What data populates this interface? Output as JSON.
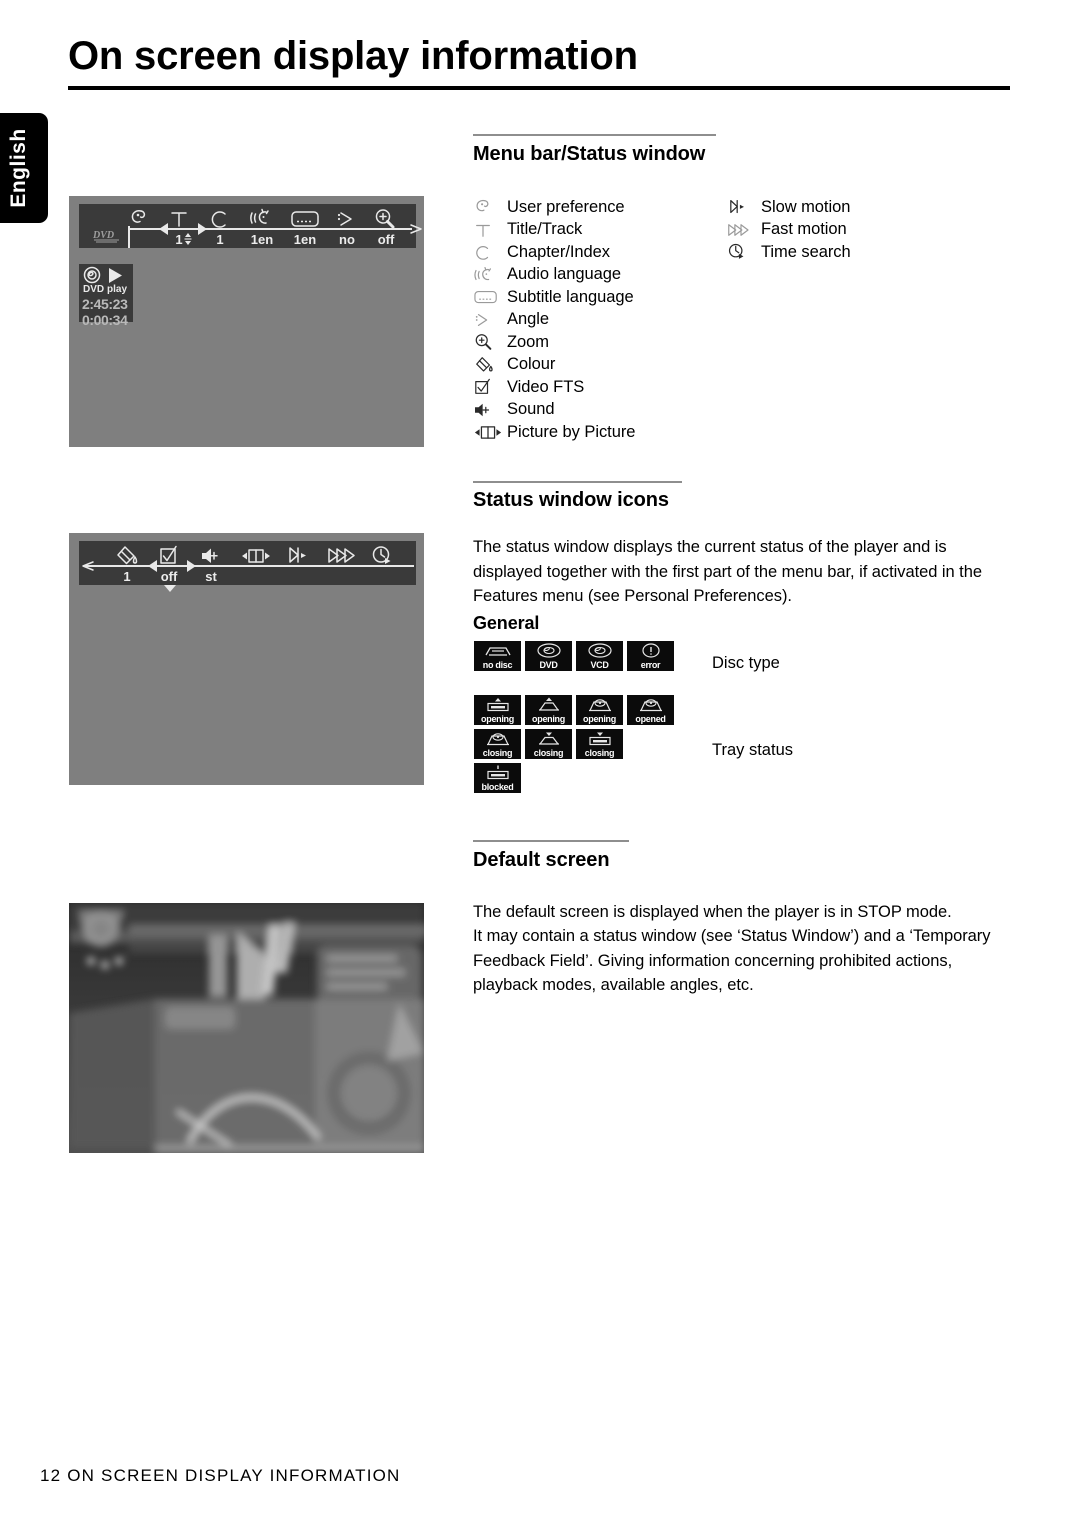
{
  "document": {
    "language_tab": "English",
    "page_title": "On screen display information",
    "footer": "12 ON SCREEN DISPLAY INFORMATION",
    "page_number": "12"
  },
  "sections": {
    "menu_bar": {
      "heading": "Menu bar/Status window",
      "icons_left": [
        {
          "icon": "user-preference-icon",
          "label": "User preference"
        },
        {
          "icon": "title-track-icon",
          "label": "Title/Track"
        },
        {
          "icon": "chapter-index-icon",
          "label": "Chapter/Index"
        },
        {
          "icon": "audio-language-icon",
          "label": "Audio language"
        },
        {
          "icon": "subtitle-language-icon",
          "label": "Subtitle language"
        },
        {
          "icon": "angle-icon",
          "label": "Angle"
        },
        {
          "icon": "zoom-icon",
          "label": "Zoom"
        },
        {
          "icon": "colour-icon",
          "label": "Colour"
        },
        {
          "icon": "video-fts-icon",
          "label": "Video FTS"
        },
        {
          "icon": "sound-icon",
          "label": "Sound"
        },
        {
          "icon": "picture-by-picture-icon",
          "label": "Picture by Picture"
        }
      ],
      "icons_right": [
        {
          "icon": "slow-motion-icon",
          "label": "Slow motion"
        },
        {
          "icon": "fast-motion-icon",
          "label": "Fast motion"
        },
        {
          "icon": "time-search-icon",
          "label": "Time search"
        }
      ]
    },
    "status_window": {
      "heading": "Status window icons",
      "body": "The status window displays the current status of the player and is displayed together with the first part of the menu bar, if activated in the Features menu (see Personal Preferences).",
      "general_heading": "General",
      "disc_type_label": "Disc type",
      "tray_status_label": "Tray status",
      "disc_type_tiles": [
        {
          "icon": "no-disc-icon",
          "caption": "no disc"
        },
        {
          "icon": "dvd-disc-icon",
          "caption": "DVD"
        },
        {
          "icon": "vcd-disc-icon",
          "caption": "VCD"
        },
        {
          "icon": "error-icon",
          "caption": "error"
        }
      ],
      "tray_status_tiles_row1": [
        {
          "icon": "tray-opening-1-icon",
          "caption": "opening"
        },
        {
          "icon": "tray-opening-2-icon",
          "caption": "opening"
        },
        {
          "icon": "tray-opening-3-icon",
          "caption": "opening"
        },
        {
          "icon": "tray-opened-icon",
          "caption": "opened"
        }
      ],
      "tray_status_tiles_row2": [
        {
          "icon": "tray-closing-1-icon",
          "caption": "closing"
        },
        {
          "icon": "tray-closing-2-icon",
          "caption": "closing"
        },
        {
          "icon": "tray-closing-3-icon",
          "caption": "closing"
        }
      ],
      "tray_status_tiles_row3": [
        {
          "icon": "tray-blocked-icon",
          "caption": "blocked"
        }
      ]
    },
    "default_screen": {
      "heading": "Default screen",
      "body_line1": "The default screen is displayed when the player is in STOP mode.",
      "body_line2": "It may contain a status window (see ‘Status Window’) and a ‘Temporary Feedback Field’. Giving information concerning prohibited actions, playback modes, available angles, etc."
    }
  },
  "screen_mock_1": {
    "name": "menu-bar-screen",
    "disc_badge": "DVD",
    "menu_items": [
      {
        "icon": "user-preference-icon",
        "value": ""
      },
      {
        "icon": "title-track-icon",
        "value": "1"
      },
      {
        "icon": "chapter-index-icon",
        "value": "1"
      },
      {
        "icon": "audio-language-icon",
        "value": "1en"
      },
      {
        "icon": "subtitle-language-icon",
        "value": "1en"
      },
      {
        "icon": "angle-icon",
        "value": "no"
      },
      {
        "icon": "zoom-icon",
        "value": "off"
      }
    ],
    "status_window": {
      "disc_type": "DVD",
      "play_state": "play",
      "total_time": "2:45:23",
      "elapsed_time": "0:00:34"
    }
  },
  "screen_mock_2": {
    "name": "second-menu-bar-screen",
    "menu_items": [
      {
        "icon": "colour-icon",
        "value": "1"
      },
      {
        "icon": "video-fts-icon",
        "value": "off"
      },
      {
        "icon": "sound-icon",
        "value": "st"
      },
      {
        "icon": "picture-by-picture-icon",
        "value": ""
      },
      {
        "icon": "slow-motion-icon",
        "value": ""
      },
      {
        "icon": "fast-motion-icon",
        "value": ""
      },
      {
        "icon": "time-search-icon",
        "value": ""
      }
    ]
  },
  "screen_mock_3": {
    "name": "default-screen-photo",
    "description": "blurred grayscale photo of audio equipment"
  },
  "colors": {
    "screen_background": "#7f7f7f",
    "menu_bar_background": "#3a3a3a",
    "text": "#000000",
    "rule": "#8e8e8e",
    "tile_background": "#0b0b0b"
  }
}
